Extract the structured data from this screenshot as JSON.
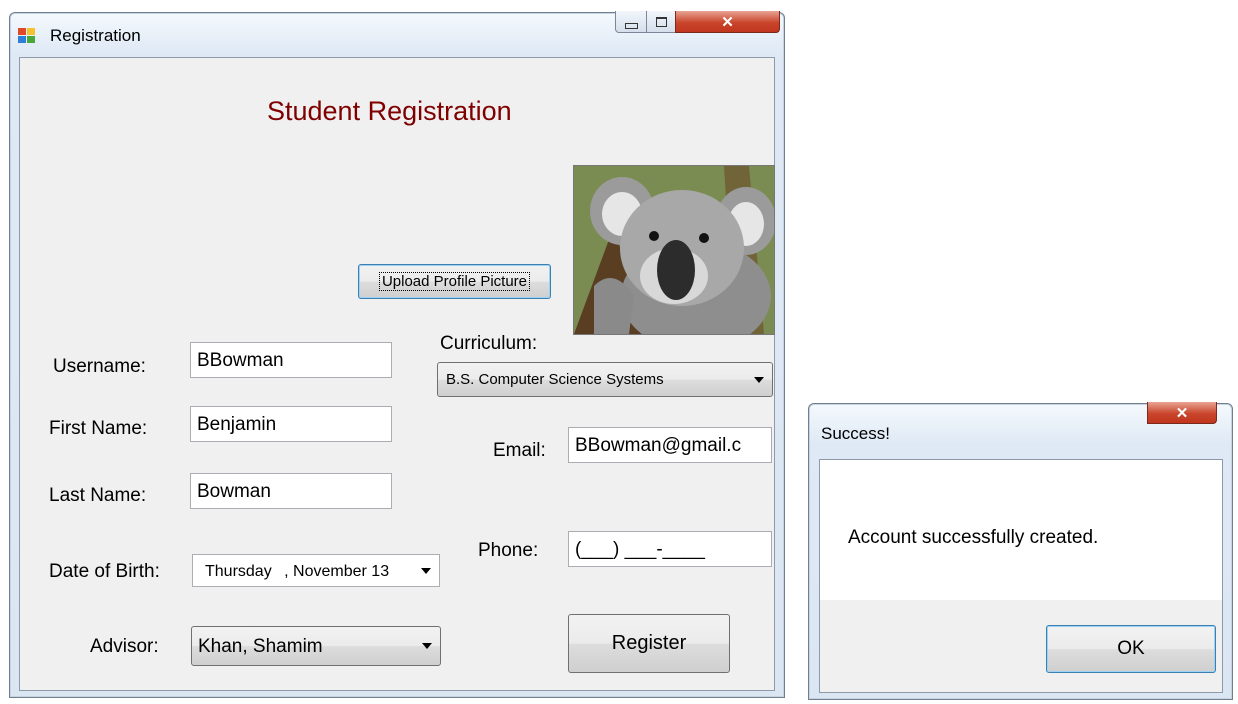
{
  "main_window": {
    "title": "Registration",
    "heading": "Student Registration",
    "upload_button": "Upload Profile Picture",
    "profile_picture": "koala",
    "labels": {
      "username": "Username:",
      "first_name": "First Name:",
      "last_name": "Last Name:",
      "date_of_birth": "Date of Birth:",
      "advisor": "Advisor:",
      "curriculum": "Curriculum:",
      "email": "Email:",
      "phone": "Phone:"
    },
    "values": {
      "username": "BBowman",
      "first_name": "Benjamin",
      "last_name": "Bowman",
      "date_of_birth_day": "Thursday",
      "date_of_birth_rest": ", November 13",
      "advisor": "Khan, Shamim",
      "curriculum": "B.S. Computer Science Systems",
      "email": "BBowman@gmail.c",
      "phone": "(___) ___-____"
    },
    "register_button": "Register"
  },
  "success_dialog": {
    "title": "Success!",
    "message": "Account successfully created.",
    "ok_button": "OK"
  },
  "colors": {
    "heading": "#800000",
    "close_button": "#c9452c",
    "window_frame": "#dbe6f3"
  }
}
